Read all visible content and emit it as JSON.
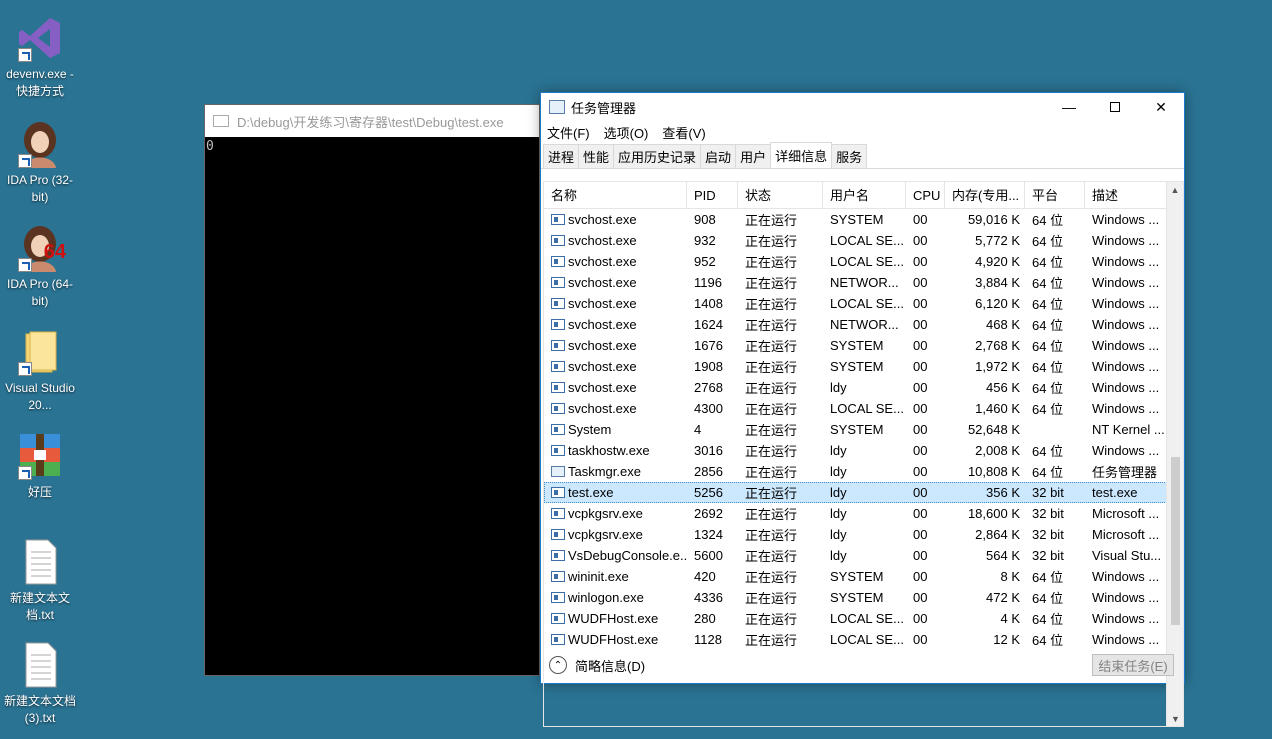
{
  "desktop": {
    "icons": [
      {
        "label": "devenv.exe - 快捷方式",
        "icon": "visual-studio-icon"
      },
      {
        "label": "IDA Pro (32-bit)",
        "icon": "ida-icon"
      },
      {
        "label": "IDA Pro (64-bit)",
        "icon": "ida64-icon",
        "badge": "64"
      },
      {
        "label": "Visual Studio 20...",
        "icon": "folder-icon"
      },
      {
        "label": "好压",
        "icon": "haozip-icon"
      },
      {
        "label": "新建文本文档.txt",
        "icon": "text-file-icon"
      },
      {
        "label": "新建文本文档(3).txt",
        "icon": "text-file-icon"
      }
    ]
  },
  "console": {
    "title": "D:\\debug\\开发练习\\寄存器\\test\\Debug\\test.exe",
    "output": "0"
  },
  "taskmanager": {
    "title": "任务管理器",
    "menu": [
      "文件(F)",
      "选项(O)",
      "查看(V)"
    ],
    "tabs": [
      "进程",
      "性能",
      "应用历史记录",
      "启动",
      "用户",
      "详细信息",
      "服务"
    ],
    "active_tab": "详细信息",
    "columns": [
      "名称",
      "PID",
      "状态",
      "用户名",
      "CPU",
      "内存(专用...",
      "平台",
      "描述"
    ],
    "rows": [
      {
        "name": "svchost.exe",
        "pid": "908",
        "status": "正在运行",
        "user": "SYSTEM",
        "cpu": "00",
        "mem": "59,016 K",
        "plat": "64 位",
        "desc": "Windows ..."
      },
      {
        "name": "svchost.exe",
        "pid": "932",
        "status": "正在运行",
        "user": "LOCAL SE...",
        "cpu": "00",
        "mem": "5,772 K",
        "plat": "64 位",
        "desc": "Windows ..."
      },
      {
        "name": "svchost.exe",
        "pid": "952",
        "status": "正在运行",
        "user": "LOCAL SE...",
        "cpu": "00",
        "mem": "4,920 K",
        "plat": "64 位",
        "desc": "Windows ..."
      },
      {
        "name": "svchost.exe",
        "pid": "1196",
        "status": "正在运行",
        "user": "NETWOR...",
        "cpu": "00",
        "mem": "3,884 K",
        "plat": "64 位",
        "desc": "Windows ..."
      },
      {
        "name": "svchost.exe",
        "pid": "1408",
        "status": "正在运行",
        "user": "LOCAL SE...",
        "cpu": "00",
        "mem": "6,120 K",
        "plat": "64 位",
        "desc": "Windows ..."
      },
      {
        "name": "svchost.exe",
        "pid": "1624",
        "status": "正在运行",
        "user": "NETWOR...",
        "cpu": "00",
        "mem": "468 K",
        "plat": "64 位",
        "desc": "Windows ..."
      },
      {
        "name": "svchost.exe",
        "pid": "1676",
        "status": "正在运行",
        "user": "SYSTEM",
        "cpu": "00",
        "mem": "2,768 K",
        "plat": "64 位",
        "desc": "Windows ..."
      },
      {
        "name": "svchost.exe",
        "pid": "1908",
        "status": "正在运行",
        "user": "SYSTEM",
        "cpu": "00",
        "mem": "1,972 K",
        "plat": "64 位",
        "desc": "Windows ..."
      },
      {
        "name": "svchost.exe",
        "pid": "2768",
        "status": "正在运行",
        "user": "ldy",
        "cpu": "00",
        "mem": "456 K",
        "plat": "64 位",
        "desc": "Windows ..."
      },
      {
        "name": "svchost.exe",
        "pid": "4300",
        "status": "正在运行",
        "user": "LOCAL SE...",
        "cpu": "00",
        "mem": "1,460 K",
        "plat": "64 位",
        "desc": "Windows ..."
      },
      {
        "name": "System",
        "pid": "4",
        "status": "正在运行",
        "user": "SYSTEM",
        "cpu": "00",
        "mem": "52,648 K",
        "plat": "",
        "desc": "NT Kernel ..."
      },
      {
        "name": "taskhostw.exe",
        "pid": "3016",
        "status": "正在运行",
        "user": "ldy",
        "cpu": "00",
        "mem": "2,008 K",
        "plat": "64 位",
        "desc": "Windows ..."
      },
      {
        "name": "Taskmgr.exe",
        "pid": "2856",
        "status": "正在运行",
        "user": "ldy",
        "cpu": "00",
        "mem": "10,808 K",
        "plat": "64 位",
        "desc": "任务管理器"
      },
      {
        "name": "test.exe",
        "pid": "5256",
        "status": "正在运行",
        "user": "ldy",
        "cpu": "00",
        "mem": "356 K",
        "plat": "32 bit",
        "desc": "test.exe"
      },
      {
        "name": "vcpkgsrv.exe",
        "pid": "2692",
        "status": "正在运行",
        "user": "ldy",
        "cpu": "00",
        "mem": "18,600 K",
        "plat": "32 bit",
        "desc": "Microsoft ..."
      },
      {
        "name": "vcpkgsrv.exe",
        "pid": "1324",
        "status": "正在运行",
        "user": "ldy",
        "cpu": "00",
        "mem": "2,864 K",
        "plat": "32 bit",
        "desc": "Microsoft ..."
      },
      {
        "name": "VsDebugConsole.e...",
        "pid": "5600",
        "status": "正在运行",
        "user": "ldy",
        "cpu": "00",
        "mem": "564 K",
        "plat": "32 bit",
        "desc": "Visual Stu..."
      },
      {
        "name": "wininit.exe",
        "pid": "420",
        "status": "正在运行",
        "user": "SYSTEM",
        "cpu": "00",
        "mem": "8 K",
        "plat": "64 位",
        "desc": "Windows ..."
      },
      {
        "name": "winlogon.exe",
        "pid": "4336",
        "status": "正在运行",
        "user": "SYSTEM",
        "cpu": "00",
        "mem": "472 K",
        "plat": "64 位",
        "desc": "Windows ..."
      },
      {
        "name": "WUDFHost.exe",
        "pid": "280",
        "status": "正在运行",
        "user": "LOCAL SE...",
        "cpu": "00",
        "mem": "4 K",
        "plat": "64 位",
        "desc": "Windows ..."
      },
      {
        "name": "WUDFHost.exe",
        "pid": "1128",
        "status": "正在运行",
        "user": "LOCAL SE...",
        "cpu": "00",
        "mem": "12 K",
        "plat": "64 位",
        "desc": "Windows ..."
      }
    ],
    "selected_pid": "5256",
    "footer": {
      "fewer_details": "简略信息(D)",
      "end_task": "结束任务(E)"
    }
  }
}
